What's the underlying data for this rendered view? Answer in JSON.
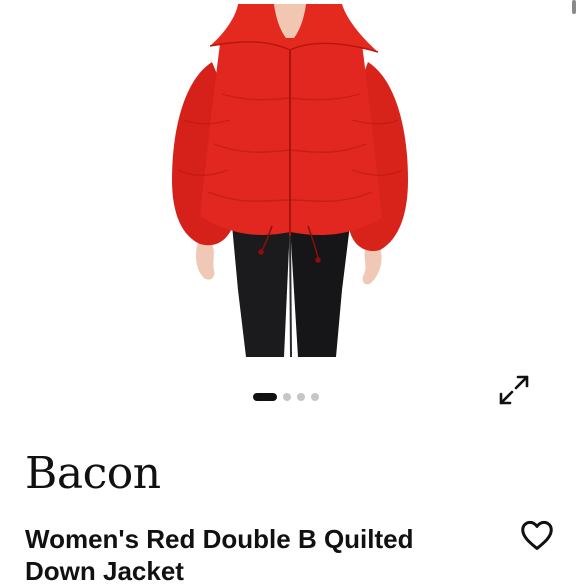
{
  "product": {
    "brand": "Bacon",
    "title": "Women's Red Double B Quilted Down Jacket"
  },
  "carousel": {
    "total_images": 4,
    "active_index": 0
  },
  "icons": {
    "expand": "expand-arrows-icon",
    "like": "heart-outline-icon"
  },
  "colors": {
    "jacket": "#e1271f",
    "text": "#111111",
    "dot_active": "#111111",
    "dot_inactive": "#c6c6c6"
  }
}
